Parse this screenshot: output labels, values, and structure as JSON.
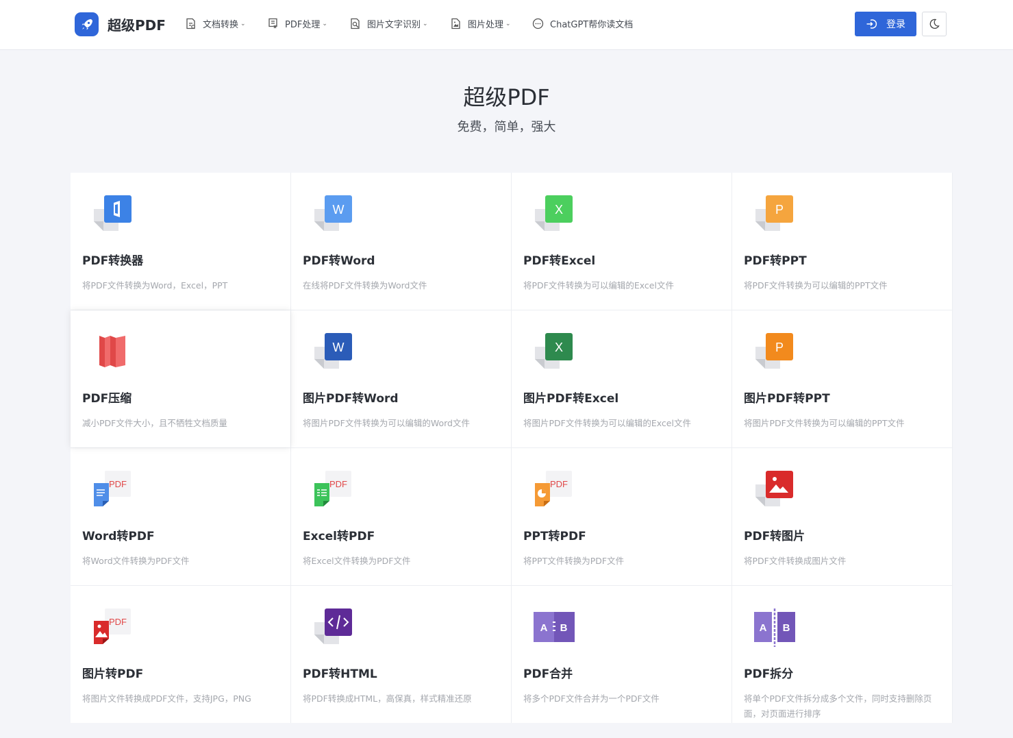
{
  "header": {
    "brand": "超级PDF",
    "nav": [
      {
        "label": "文档转换",
        "chevron": "⌄"
      },
      {
        "label": "PDF处理",
        "chevron": "⌄"
      },
      {
        "label": "图片文字识别",
        "chevron": "⌄"
      },
      {
        "label": "图片处理",
        "chevron": "⌄"
      },
      {
        "label": "ChatGPT帮你读文档",
        "chevron": ""
      }
    ],
    "login_label": "登录",
    "accent_color": "#2f66d9"
  },
  "hero": {
    "title": "超级PDF",
    "subtitle": "免费，简单，强大"
  },
  "tools": [
    {
      "title": "PDF转换器",
      "desc": "将PDF文件转换为Word，Excel，PPT",
      "icon": "office-icon"
    },
    {
      "title": "PDF转Word",
      "desc": "在线将PDF文件转换为Word文件",
      "icon": "word-icon"
    },
    {
      "title": "PDF转Excel",
      "desc": "将PDF文件转换为可以编辑的Excel文件",
      "icon": "excel-icon"
    },
    {
      "title": "PDF转PPT",
      "desc": "将PDF文件转换为可以编辑的PPT文件",
      "icon": "ppt-icon"
    },
    {
      "title": "PDF压缩",
      "desc": "减小PDF文件大小，且不牺牲文档质量",
      "icon": "compress-icon"
    },
    {
      "title": "图片PDF转Word",
      "desc": "将图片PDF文件转换为可以编辑的Word文件",
      "icon": "word-dark-icon"
    },
    {
      "title": "图片PDF转Excel",
      "desc": "将图片PDF文件转换为可以编辑的Excel文件",
      "icon": "excel-dark-icon"
    },
    {
      "title": "图片PDF转PPT",
      "desc": "将图片PDF文件转换为可以编辑的PPT文件",
      "icon": "ppt-dark-icon"
    },
    {
      "title": "Word转PDF",
      "desc": "将Word文件转换为PDF文件",
      "icon": "word-to-pdf-icon"
    },
    {
      "title": "Excel转PDF",
      "desc": "将Excel文件转换为PDF文件",
      "icon": "excel-to-pdf-icon"
    },
    {
      "title": "PPT转PDF",
      "desc": "将PPT文件转换为PDF文件",
      "icon": "ppt-to-pdf-icon"
    },
    {
      "title": "PDF转图片",
      "desc": "将PDF文件转换成图片文件",
      "icon": "image-icon"
    },
    {
      "title": "图片转PDF",
      "desc": "将图片文件转换成PDF文件，支持JPG，PNG",
      "icon": "image-to-pdf-icon"
    },
    {
      "title": "PDF转HTML",
      "desc": "将PDF转换成HTML，高保真，样式精准还原",
      "icon": "html-icon"
    },
    {
      "title": "PDF合并",
      "desc": "将多个PDF文件合并为一个PDF文件",
      "icon": "merge-icon"
    },
    {
      "title": "PDF拆分",
      "desc": "将单个PDF文件拆分成多个文件，同时支持删除页面，对页面进行排序",
      "icon": "split-icon"
    }
  ],
  "icon_glyphs": {
    "word": "W",
    "excel": "X",
    "ppt": "P",
    "pdf": "PDF",
    "a": "A",
    "b": "B"
  }
}
